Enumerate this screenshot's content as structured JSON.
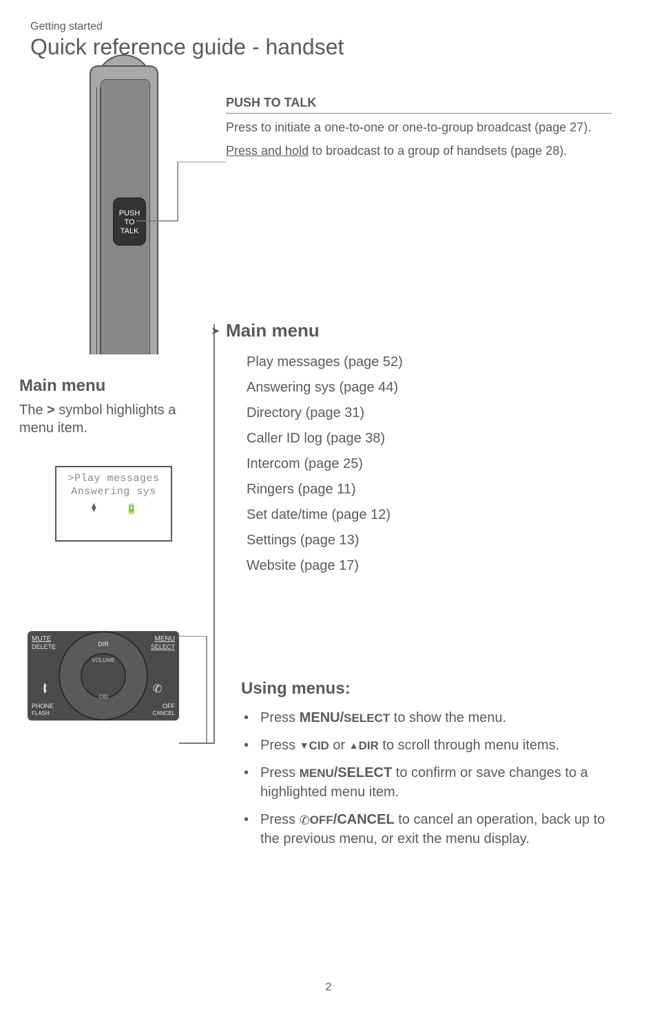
{
  "header": {
    "section": "Getting started",
    "title": "Quick reference guide - handset"
  },
  "handset": {
    "ptt_button_line1": "PUSH",
    "ptt_button_line2": "TO",
    "ptt_button_line3": "TALK"
  },
  "ptt": {
    "heading": "PUSH TO TALK",
    "para1_a": "Press to initiate a one-to-one or one-to-group broadcast (page 27).",
    "para2_lead": "Press and hold",
    "para2_rest": " to broadcast to a group of handsets (page 28)."
  },
  "main_menu_right": {
    "heading": "Main menu",
    "items": [
      "Play messages (page 52)",
      "Answering sys (page 44)",
      "Directory (page 31)",
      "Caller ID log (page 38)",
      "Intercom (page 25)",
      "Ringers (page 11)",
      "Set date/time (page 12)",
      "Settings (page 13)",
      "Website (page 17)"
    ]
  },
  "main_menu_left": {
    "heading": "Main menu",
    "text_a": "The ",
    "symbol": ">",
    "text_b": " symbol highlights a menu item."
  },
  "lcd": {
    "line1": ">Play messages",
    "line2": "Answering sys"
  },
  "keypad": {
    "mute": "MUTE",
    "delete": "DELETE",
    "menu": "MENU",
    "select": "SELECT",
    "dir": "DIR",
    "volume": "VOLUME",
    "cid": "CID",
    "phone": "PHONE",
    "flash": "FLASH",
    "off": "OFF",
    "cancel": "CANCEL"
  },
  "using_menus": {
    "heading": "Using menus:",
    "item1_a": "Press ",
    "item1_b": "MENU/",
    "item1_c": "SELECT",
    "item1_d": " to show the menu.",
    "item2_a": "Press ",
    "item2_cid": "CID",
    "item2_or": " or ",
    "item2_dir": "DIR",
    "item2_b": " to scroll through menu items.",
    "item3_a": "Press ",
    "item3_b": "MENU",
    "item3_c": "/SELECT",
    "item3_d": " to confirm or save changes to a highlighted menu item.",
    "item4_a": "Press ",
    "item4_b": "OFF",
    "item4_c": "/CANCEL",
    "item4_d": " to cancel an operation, back up to the previous menu, or exit the menu display."
  },
  "page_number": "2"
}
